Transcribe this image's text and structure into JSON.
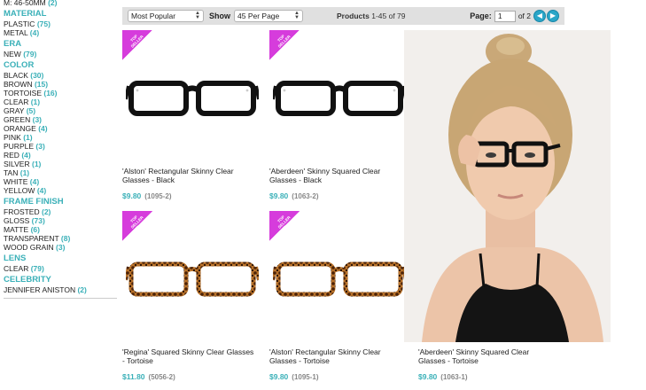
{
  "sidebar": {
    "top_filter": {
      "label": "M: 46-50MM",
      "count": "(2)"
    },
    "sections": [
      {
        "title": "MATERIAL",
        "items": [
          {
            "label": "PLASTIC",
            "count": "(75)"
          },
          {
            "label": "METAL",
            "count": "(4)"
          }
        ]
      },
      {
        "title": "ERA",
        "items": [
          {
            "label": "NEW",
            "count": "(79)"
          }
        ]
      },
      {
        "title": "COLOR",
        "items": [
          {
            "label": "BLACK",
            "count": "(30)"
          },
          {
            "label": "BROWN",
            "count": "(15)"
          },
          {
            "label": "TORTOISE",
            "count": "(16)"
          },
          {
            "label": "CLEAR",
            "count": "(1)"
          },
          {
            "label": "GRAY",
            "count": "(5)"
          },
          {
            "label": "GREEN",
            "count": "(3)"
          },
          {
            "label": "ORANGE",
            "count": "(4)"
          },
          {
            "label": "PINK",
            "count": "(1)"
          },
          {
            "label": "PURPLE",
            "count": "(3)"
          },
          {
            "label": "RED",
            "count": "(4)"
          },
          {
            "label": "SILVER",
            "count": "(1)"
          },
          {
            "label": "TAN",
            "count": "(1)"
          },
          {
            "label": "WHITE",
            "count": "(4)"
          },
          {
            "label": "YELLOW",
            "count": "(4)"
          }
        ]
      },
      {
        "title": "FRAME FINISH",
        "items": [
          {
            "label": "FROSTED",
            "count": "(2)"
          },
          {
            "label": "GLOSS",
            "count": "(73)"
          },
          {
            "label": "MATTE",
            "count": "(6)"
          },
          {
            "label": "TRANSPARENT",
            "count": "(8)"
          },
          {
            "label": "WOOD GRAIN",
            "count": "(3)"
          }
        ]
      },
      {
        "title": "LENS",
        "items": [
          {
            "label": "CLEAR",
            "count": "(79)"
          }
        ]
      },
      {
        "title": "CELEBRITY",
        "items": [
          {
            "label": "JENNIFER ANISTON",
            "count": "(2)"
          }
        ]
      }
    ]
  },
  "toolbar": {
    "sort_value": "Most Popular",
    "show_label": "Show",
    "per_page_value": "45 Per Page",
    "products_label": "Products",
    "products_range": "1-45 of 79",
    "page_label": "Page:",
    "page_value": "1",
    "page_of": "of 2",
    "prev_icon": "left-arrow-circle-icon",
    "next_icon": "right-arrow-circle-icon"
  },
  "badge_text": "TOP SELLER",
  "products": [
    {
      "name": "'Alston' Rectangular Skinny Clear Glasses - Black",
      "price": "$9.80",
      "sku": "(1095-2)",
      "frame": "black"
    },
    {
      "name": "'Aberdeen' Skinny Squared Clear Glasses - Black",
      "price": "$9.80",
      "sku": "(1063-2)",
      "frame": "black"
    },
    {
      "name": "'Regina' Squared Skinny Clear Glasses - Tortoise",
      "price": "$11.80",
      "sku": "(5056-2)",
      "frame": "tortoise"
    },
    {
      "name": "'Alston' Rectangular Skinny Clear Glasses - Tortoise",
      "price": "$9.80",
      "sku": "(1095-1)",
      "frame": "tortoise"
    },
    {
      "name": "'Aberdeen' Skinny Squared Clear Glasses - Tortoise",
      "price": "$9.80",
      "sku": "(1063-1)",
      "frame": "tortoise"
    }
  ],
  "colors": {
    "accent_teal": "#3ab0b8",
    "badge_magenta": "#d63cdc",
    "nav_blue": "#2aa6c8",
    "toolbar_bg": "#e0e0e0"
  }
}
